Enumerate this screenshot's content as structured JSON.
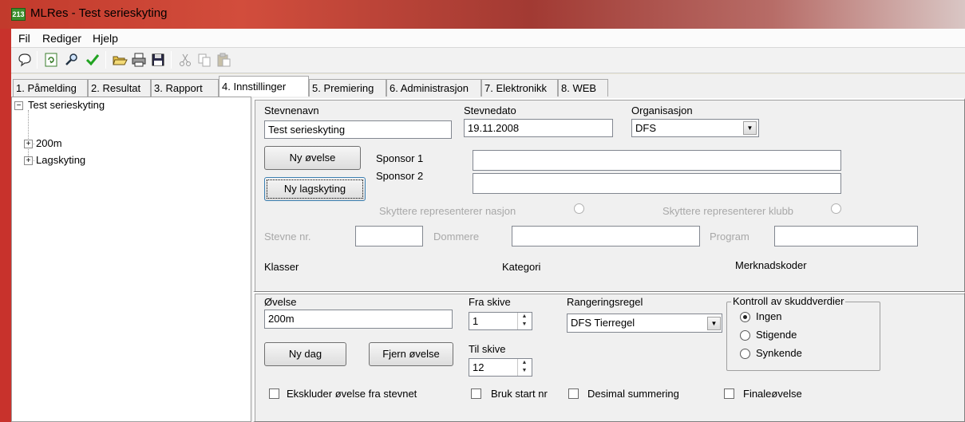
{
  "window": {
    "title": "MLRes - Test serieskyting",
    "icon": "app-icon",
    "icon_text": "213"
  },
  "menu": [
    {
      "label": "Fil"
    },
    {
      "label": "Rediger"
    },
    {
      "label": "Hjelp"
    }
  ],
  "toolbar": {
    "icons": [
      "help-pointer-icon",
      "refresh-icon",
      "search-icon",
      "check-icon",
      "open-folder-icon",
      "print-icon",
      "save-icon",
      "cut-icon",
      "copy-icon",
      "paste-icon"
    ]
  },
  "tabs": [
    {
      "label": "1. Påmelding"
    },
    {
      "label": "2. Resultat"
    },
    {
      "label": "3. Rapport"
    },
    {
      "label": "4. Innstillinger",
      "active": true
    },
    {
      "label": "5. Premiering"
    },
    {
      "label": "6. Administrasjon"
    },
    {
      "label": "7. Elektronikk"
    },
    {
      "label": "8. WEB"
    }
  ],
  "tree": {
    "root": {
      "label": "Test serieskyting",
      "toggle": "−"
    },
    "children": [
      {
        "label": "200m",
        "toggle": "+"
      },
      {
        "label": "Lagskyting",
        "toggle": "+"
      }
    ]
  },
  "event": {
    "name_label": "Stevnenavn",
    "name_value": "Test serieskyting",
    "date_label": "Stevnedato",
    "date_value": "19.11.2008",
    "org_label": "Organisasjon",
    "org_value": "DFS",
    "new_exercise_button": "Ny øvelse",
    "new_team_button": "Ny lagskyting",
    "sponsor1_label": "Sponsor 1",
    "sponsor1_value": "",
    "sponsor2_label": "Sponsor 2",
    "sponsor2_value": "",
    "nation_label": "Skyttere representerer nasjon",
    "club_label": "Skyttere representerer klubb",
    "event_nr_label": "Stevne nr.",
    "event_nr_value": "",
    "judges_label": "Dommere",
    "judges_value": "",
    "program_label": "Program",
    "program_value": "",
    "classes_label": "Klasser",
    "category_label": "Kategori",
    "mark_codes_label": "Merknadskoder"
  },
  "exercise": {
    "name_label": "Øvelse",
    "name_value": "200m",
    "from_label": "Fra skive",
    "from_value": "1",
    "to_label": "Til skive",
    "to_value": "12",
    "ranking_label": "Rangeringsregel",
    "ranking_value": "DFS Tierregel",
    "new_day_button": "Ny dag",
    "remove_button": "Fjern øvelse",
    "control_legend": "Kontroll av skuddverdier",
    "control_options": [
      {
        "label": "Ingen",
        "selected": true
      },
      {
        "label": "Stigende",
        "selected": false
      },
      {
        "label": "Synkende",
        "selected": false
      }
    ],
    "exclude_label": "Ekskluder øvelse fra stevnet",
    "start_nr_label": "Bruk start nr",
    "decimal_label": "Desimal summering",
    "final_label": "Finaleøvelse"
  }
}
